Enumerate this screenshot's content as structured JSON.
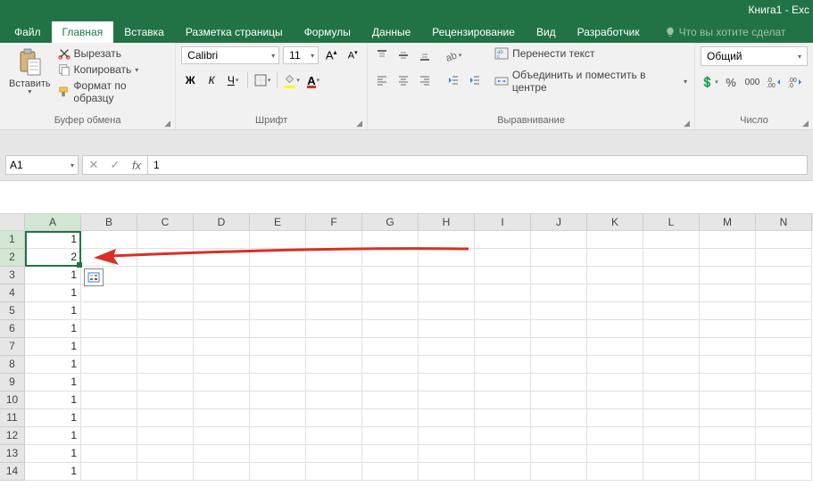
{
  "title": "Книга1 - Exc",
  "tabs": {
    "file": "Файл",
    "home": "Главная",
    "insert": "Вставка",
    "pagelayout": "Разметка страницы",
    "formulas": "Формулы",
    "data": "Данные",
    "review": "Рецензирование",
    "view": "Вид",
    "developer": "Разработчик"
  },
  "tellme": "Что вы хотите сделат",
  "ribbon": {
    "clipboard": {
      "paste": "Вставить",
      "cut": "Вырезать",
      "copy": "Копировать",
      "formatpainter": "Формат по образцу",
      "label": "Буфер обмена"
    },
    "font": {
      "name": "Calibri",
      "size": "11",
      "bold": "Ж",
      "italic": "К",
      "underline": "Ч",
      "label": "Шрифт"
    },
    "alignment": {
      "wrap": "Перенести текст",
      "merge": "Объединить и поместить в центре",
      "label": "Выравнивание"
    },
    "number": {
      "format": "Общий",
      "label": "Число"
    }
  },
  "namebox": "A1",
  "formula": "1",
  "columns": [
    "A",
    "B",
    "C",
    "D",
    "E",
    "F",
    "G",
    "H",
    "I",
    "J",
    "K",
    "L",
    "M",
    "N"
  ],
  "rows": [
    {
      "n": "1",
      "a": "1"
    },
    {
      "n": "2",
      "a": "2"
    },
    {
      "n": "3",
      "a": "1"
    },
    {
      "n": "4",
      "a": "1"
    },
    {
      "n": "5",
      "a": "1"
    },
    {
      "n": "6",
      "a": "1"
    },
    {
      "n": "7",
      "a": "1"
    },
    {
      "n": "8",
      "a": "1"
    },
    {
      "n": "9",
      "a": "1"
    },
    {
      "n": "10",
      "a": "1"
    },
    {
      "n": "11",
      "a": "1"
    },
    {
      "n": "12",
      "a": "1"
    },
    {
      "n": "13",
      "a": "1"
    },
    {
      "n": "14",
      "a": "1"
    }
  ],
  "percent_sym": "%",
  "thousands_sym": "000",
  "currency_sym": "$"
}
